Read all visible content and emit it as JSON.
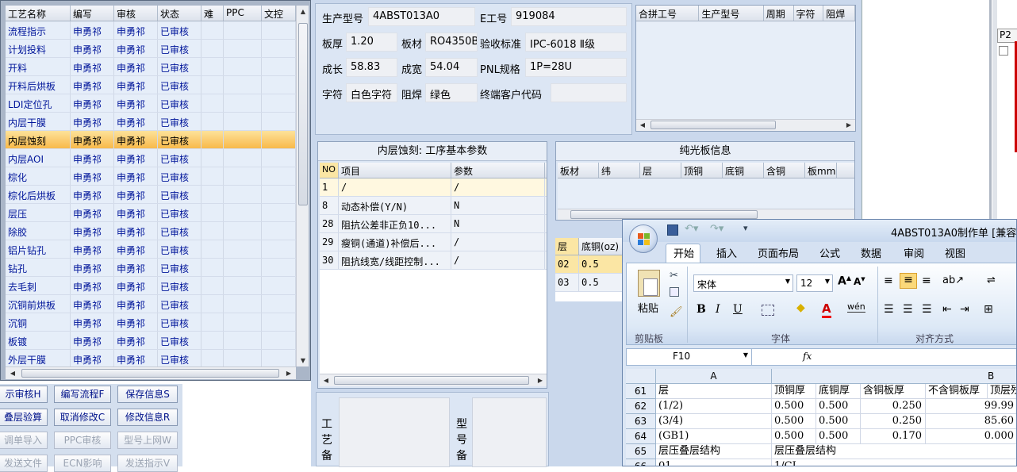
{
  "process_grid": {
    "columns": [
      "工艺名称",
      "编写",
      "审核",
      "状态",
      "难",
      "PPC",
      "文控"
    ],
    "rows": [
      [
        "流程指示",
        "申勇祁",
        "申勇祁",
        "已审核"
      ],
      [
        "计划投料",
        "申勇祁",
        "申勇祁",
        "已审核"
      ],
      [
        "开料",
        "申勇祁",
        "申勇祁",
        "已审核"
      ],
      [
        "开料后烘板",
        "申勇祁",
        "申勇祁",
        "已审核"
      ],
      [
        "LDI定位孔",
        "申勇祁",
        "申勇祁",
        "已审核"
      ],
      [
        "内层干膜",
        "申勇祁",
        "申勇祁",
        "已审核"
      ],
      [
        "内层蚀刻",
        "申勇祁",
        "申勇祁",
        "已审核"
      ],
      [
        "内层AOI",
        "申勇祁",
        "申勇祁",
        "已审核"
      ],
      [
        "棕化",
        "申勇祁",
        "申勇祁",
        "已审核"
      ],
      [
        "棕化后烘板",
        "申勇祁",
        "申勇祁",
        "已审核"
      ],
      [
        "层压",
        "申勇祁",
        "申勇祁",
        "已审核"
      ],
      [
        "除胶",
        "申勇祁",
        "申勇祁",
        "已审核"
      ],
      [
        "铝片钻孔",
        "申勇祁",
        "申勇祁",
        "已审核"
      ],
      [
        "钻孔",
        "申勇祁",
        "申勇祁",
        "已审核"
      ],
      [
        "去毛刺",
        "申勇祁",
        "申勇祁",
        "已审核"
      ],
      [
        "沉铜前烘板",
        "申勇祁",
        "申勇祁",
        "已审核"
      ],
      [
        "沉铜",
        "申勇祁",
        "申勇祁",
        "已审核"
      ],
      [
        "板镀",
        "申勇祁",
        "申勇祁",
        "已审核"
      ],
      [
        "外层干膜",
        "申勇祁",
        "申勇祁",
        "已审核"
      ]
    ],
    "selected_index": 6
  },
  "buttons": {
    "row1": [
      "示审核H",
      "编写流程F",
      "保存信息S"
    ],
    "row2": [
      "叠层验算",
      "取消修改C",
      "修改信息R"
    ],
    "row3": [
      "调单导入",
      "PPC审核",
      "型号上网W"
    ],
    "row4": [
      "发送文件",
      "ECN影响",
      "发送指示V"
    ]
  },
  "info": {
    "model_label": "生产型号",
    "model_value": "4ABST013A0",
    "e_label": "E工号",
    "e_value": "919084",
    "thickness_label": "板厚",
    "thickness_value": "1.20",
    "material_label": "板材",
    "material_value": "RO4350B",
    "standard_label": "验收标准",
    "standard_value": "IPC-6018 Ⅱ级",
    "length_label": "成长",
    "length_value": "58.83",
    "width_label": "成宽",
    "width_value": "54.04",
    "pnl_label": "PNL规格",
    "pnl_value": "1P=28U",
    "char_label": "字符",
    "char_value": "白色字符",
    "mask_label": "阻焊",
    "mask_value": "绿色",
    "customer_label": "终端客户代码",
    "customer_value": ""
  },
  "merge_grid": {
    "columns": [
      "合拼工号",
      "生产型号",
      "周期",
      "字符",
      "阻焊"
    ]
  },
  "param_panel": {
    "title": "内层蚀刻: 工序基本参数",
    "columns": [
      "NO",
      "项目",
      "参数"
    ],
    "rows": [
      [
        "1",
        "/",
        "/"
      ],
      [
        "8",
        "动态补偿(Y/N)",
        "N"
      ],
      [
        "28",
        "阻抗公差非正负10...",
        "N"
      ],
      [
        "29",
        "瘦铜(通道)补偿后...",
        "/"
      ],
      [
        "30",
        "阻抗线宽/线距控制...",
        "/"
      ]
    ]
  },
  "bare_board": {
    "title": "纯光板信息",
    "columns": [
      "板材",
      "纬",
      "层",
      "顶铜",
      "底铜",
      "含铜",
      "板mm"
    ]
  },
  "layer_grid": {
    "columns": [
      "层",
      "底铜(oz)"
    ],
    "rows": [
      [
        "02",
        "0.5"
      ],
      [
        "03",
        "0.5"
      ]
    ]
  },
  "remarks": {
    "process_label": "工\n艺\n备",
    "model_label": "型\n号\n备"
  },
  "side_label": "P2",
  "excel": {
    "title": "4ABST013A0制作单  [兼容模",
    "tabs": [
      "开始",
      "插入",
      "页面布局",
      "公式",
      "数据",
      "审阅",
      "视图"
    ],
    "paste_label": "粘贴",
    "clipboard_label": "剪贴板",
    "font_group_label": "字体",
    "align_group_label": "对齐方式",
    "font_name": "宋体",
    "font_size": "12",
    "name_box": "F10",
    "fx": "fx",
    "col_a": "A",
    "col_b": "B",
    "rows": [
      {
        "n": "61",
        "a": "层",
        "c": [
          "顶铜厚",
          "底铜厚",
          "含铜板厚",
          "不含铜板厚",
          "顶层残"
        ]
      },
      {
        "n": "62",
        "a": "(1/2)",
        "c": [
          "0.500",
          "0.500",
          "0.250",
          "99.99"
        ]
      },
      {
        "n": "63",
        "a": "(3/4)",
        "c": [
          "0.500",
          "0.500",
          "0.250",
          "85.60"
        ]
      },
      {
        "n": "64",
        "a": "(GB1)",
        "c": [
          "0.500",
          "0.500",
          "0.170",
          "0.000"
        ]
      },
      {
        "n": "65",
        "a": "层压叠层结构",
        "c": [
          "层压叠层结构"
        ]
      },
      {
        "n": "66",
        "a": "01",
        "c": [
          "1/CL"
        ]
      }
    ]
  }
}
